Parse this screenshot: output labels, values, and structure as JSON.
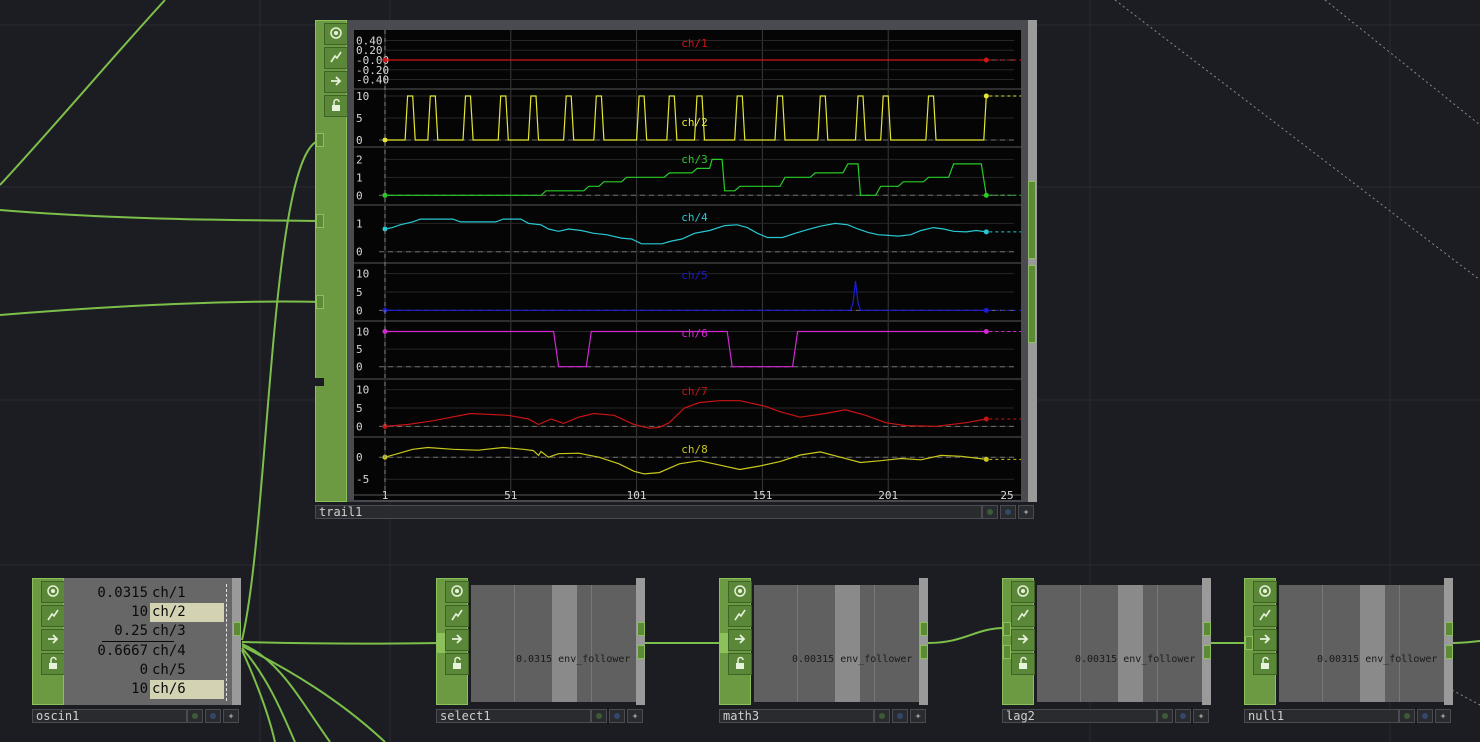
{
  "nodes": {
    "trail": {
      "name": "trail1"
    },
    "oscin": {
      "name": "oscin1",
      "values": [
        {
          "value": "0.0315",
          "channel": "ch/1"
        },
        {
          "value": "10",
          "channel": "ch/2"
        },
        {
          "value": "0.25",
          "channel": "ch/3"
        },
        {
          "value": "0.6667",
          "channel": "ch/4"
        },
        {
          "value": "0",
          "channel": "ch/5"
        },
        {
          "value": "10",
          "channel": "ch/6"
        }
      ]
    },
    "select": {
      "name": "select1",
      "value": "0.0315",
      "channel": "env_follower"
    },
    "math": {
      "name": "math3",
      "value": "0.00315",
      "channel": "env_follower"
    },
    "lag": {
      "name": "lag2",
      "value": "0.00315",
      "channel": "env_follower"
    },
    "null": {
      "name": "null1",
      "value": "0.00315",
      "channel": "env_follower"
    }
  },
  "icons": [
    "viewer-active-icon",
    "bypass-icon",
    "display-flag-icon",
    "lock-icon",
    "render-dot-icon",
    "clone-dot-icon",
    "expand-icon"
  ],
  "colors": {
    "background": "#1c1d22",
    "node_green": "#6b9a42",
    "wire": "#7cbf4a"
  },
  "chart_data": {
    "type": "line",
    "x_ticks": [
      "1",
      "51",
      "101",
      "151",
      "201",
      "25"
    ],
    "x_range": [
      1,
      251
    ],
    "series": [
      {
        "name": "ch/1",
        "color": "#d21414",
        "ticks": [
          "0.40",
          "0.20",
          "-0.00",
          "-0.20",
          "-0.40"
        ],
        "ylim": [
          -0.45,
          0.45
        ],
        "points": [
          [
            1,
            0
          ],
          [
            240,
            0
          ]
        ]
      },
      {
        "name": "ch/2",
        "color": "#e6e632",
        "ticks": [
          "10",
          "5",
          "0"
        ],
        "ylim": [
          0,
          10
        ],
        "points": [
          [
            1,
            0
          ],
          [
            9,
            0
          ],
          [
            10,
            10
          ],
          [
            12,
            10
          ],
          [
            13,
            0
          ],
          [
            18,
            0
          ],
          [
            19,
            10
          ],
          [
            21,
            10
          ],
          [
            22,
            0
          ],
          [
            32,
            0
          ],
          [
            33,
            10
          ],
          [
            35,
            10
          ],
          [
            36,
            0
          ],
          [
            46,
            0
          ],
          [
            47,
            10
          ],
          [
            49,
            10
          ],
          [
            50,
            0
          ],
          [
            58,
            0
          ],
          [
            59,
            10
          ],
          [
            61,
            10
          ],
          [
            62,
            0
          ],
          [
            72,
            0
          ],
          [
            73,
            10
          ],
          [
            75,
            10
          ],
          [
            76,
            0
          ],
          [
            84,
            0
          ],
          [
            85,
            10
          ],
          [
            87,
            10
          ],
          [
            88,
            0
          ],
          [
            101,
            0
          ],
          [
            102,
            10
          ],
          [
            104,
            10
          ],
          [
            105,
            0
          ],
          [
            113,
            0
          ],
          [
            114,
            10
          ],
          [
            116,
            10
          ],
          [
            117,
            0
          ],
          [
            124,
            0
          ],
          [
            125,
            10
          ],
          [
            127,
            10
          ],
          [
            128,
            0
          ],
          [
            140,
            0
          ],
          [
            141,
            10
          ],
          [
            143,
            10
          ],
          [
            144,
            0
          ],
          [
            156,
            0
          ],
          [
            157,
            10
          ],
          [
            159,
            10
          ],
          [
            160,
            0
          ],
          [
            173,
            0
          ],
          [
            174,
            10
          ],
          [
            176,
            10
          ],
          [
            177,
            0
          ],
          [
            188,
            0
          ],
          [
            189,
            10
          ],
          [
            191,
            10
          ],
          [
            192,
            0
          ],
          [
            198,
            0
          ],
          [
            199,
            10
          ],
          [
            201,
            10
          ],
          [
            202,
            0
          ],
          [
            216,
            0
          ],
          [
            217,
            10
          ],
          [
            219,
            10
          ],
          [
            220,
            0
          ],
          [
            239,
            0
          ],
          [
            240,
            10
          ]
        ]
      },
      {
        "name": "ch/3",
        "color": "#28cc28",
        "ticks": [
          "2",
          "1",
          "0"
        ],
        "ylim": [
          -0.15,
          2.3
        ],
        "points": [
          [
            1,
            0
          ],
          [
            63,
            0
          ],
          [
            65,
            0.25
          ],
          [
            80,
            0.25
          ],
          [
            82,
            0.5
          ],
          [
            86,
            0.5
          ],
          [
            88,
            0.75
          ],
          [
            95,
            0.75
          ],
          [
            97,
            1
          ],
          [
            112,
            1
          ],
          [
            114,
            1.25
          ],
          [
            123,
            1.25
          ],
          [
            125,
            1.5
          ],
          [
            130,
            1.5
          ],
          [
            131,
            2
          ],
          [
            135,
            2
          ],
          [
            136,
            0.25
          ],
          [
            140,
            0.25
          ],
          [
            142,
            0.5
          ],
          [
            158,
            0.5
          ],
          [
            160,
            1
          ],
          [
            170,
            1
          ],
          [
            172,
            1.25
          ],
          [
            183,
            1.25
          ],
          [
            185,
            1.75
          ],
          [
            189,
            1.75
          ],
          [
            190,
            0
          ],
          [
            196,
            0
          ],
          [
            198,
            0.5
          ],
          [
            205,
            0.5
          ],
          [
            207,
            0.75
          ],
          [
            215,
            0.75
          ],
          [
            217,
            1
          ],
          [
            225,
            1
          ],
          [
            227,
            1.75
          ],
          [
            238,
            1.75
          ],
          [
            240,
            0
          ]
        ]
      },
      {
        "name": "ch/4",
        "color": "#28c8d2",
        "ticks": [
          "1",
          "0"
        ],
        "ylim": [
          -0.15,
          1.4
        ],
        "points": [
          [
            1,
            0.8
          ],
          [
            4,
            0.85
          ],
          [
            7,
            0.95
          ],
          [
            12,
            1.05
          ],
          [
            15,
            1.15
          ],
          [
            28,
            1.15
          ],
          [
            31,
            1.05
          ],
          [
            45,
            1.05
          ],
          [
            48,
            1.15
          ],
          [
            55,
            1.15
          ],
          [
            58,
            1.0
          ],
          [
            63,
            0.95
          ],
          [
            66,
            0.8
          ],
          [
            70,
            0.72
          ],
          [
            74,
            0.8
          ],
          [
            79,
            0.75
          ],
          [
            84,
            0.65
          ],
          [
            89,
            0.6
          ],
          [
            95,
            0.48
          ],
          [
            99,
            0.45
          ],
          [
            103,
            0.28
          ],
          [
            111,
            0.28
          ],
          [
            115,
            0.38
          ],
          [
            119,
            0.45
          ],
          [
            124,
            0.65
          ],
          [
            130,
            0.75
          ],
          [
            136,
            0.92
          ],
          [
            141,
            0.95
          ],
          [
            145,
            0.85
          ],
          [
            149,
            0.65
          ],
          [
            153,
            0.5
          ],
          [
            159,
            0.5
          ],
          [
            164,
            0.65
          ],
          [
            169,
            0.78
          ],
          [
            174,
            0.9
          ],
          [
            180,
            1.0
          ],
          [
            185,
            0.95
          ],
          [
            189,
            0.8
          ],
          [
            193,
            0.68
          ],
          [
            197,
            0.6
          ],
          [
            205,
            0.55
          ],
          [
            210,
            0.6
          ],
          [
            214,
            0.75
          ],
          [
            219,
            0.85
          ],
          [
            223,
            0.8
          ],
          [
            227,
            0.72
          ],
          [
            232,
            0.7
          ],
          [
            236,
            0.75
          ],
          [
            240,
            0.7
          ]
        ]
      },
      {
        "name": "ch/5",
        "color": "#1c1cd2",
        "ticks": [
          "10",
          "5",
          "0"
        ],
        "ylim": [
          -1,
          11
        ],
        "points": [
          [
            1,
            0
          ],
          [
            186,
            0
          ],
          [
            187,
            2
          ],
          [
            188,
            8
          ],
          [
            189,
            2
          ],
          [
            190,
            0
          ],
          [
            240,
            0
          ]
        ]
      },
      {
        "name": "ch/6",
        "color": "#d228d2",
        "ticks": [
          "10",
          "5",
          "0"
        ],
        "ylim": [
          -1.5,
          11
        ],
        "points": [
          [
            1,
            10
          ],
          [
            68,
            10
          ],
          [
            70,
            0
          ],
          [
            81,
            0
          ],
          [
            83,
            10
          ],
          [
            137,
            10
          ],
          [
            139,
            0
          ],
          [
            163,
            0
          ],
          [
            165,
            10
          ],
          [
            240,
            10
          ]
        ]
      },
      {
        "name": "ch/7",
        "color": "#c81414",
        "ticks": [
          "10",
          "5",
          "0"
        ],
        "ylim": [
          -1,
          11
        ],
        "points": [
          [
            1,
            0
          ],
          [
            10,
            0.5
          ],
          [
            20,
            1.5
          ],
          [
            35,
            3.5
          ],
          [
            50,
            3
          ],
          [
            58,
            2
          ],
          [
            62,
            0.5
          ],
          [
            67,
            2
          ],
          [
            72,
            0.8
          ],
          [
            78,
            2.5
          ],
          [
            84,
            3.5
          ],
          [
            92,
            3
          ],
          [
            100,
            0.5
          ],
          [
            106,
            -0.5
          ],
          [
            110,
            -0.3
          ],
          [
            114,
            1
          ],
          [
            120,
            5
          ],
          [
            126,
            6.5
          ],
          [
            134,
            7
          ],
          [
            142,
            7
          ],
          [
            152,
            5.5
          ],
          [
            158,
            4
          ],
          [
            166,
            2.5
          ],
          [
            176,
            3.5
          ],
          [
            184,
            4.5
          ],
          [
            192,
            3
          ],
          [
            200,
            1
          ],
          [
            208,
            0.2
          ],
          [
            220,
            0
          ],
          [
            232,
            1
          ],
          [
            240,
            2
          ]
        ]
      },
      {
        "name": "ch/8",
        "color": "#c8c81c",
        "ticks": [
          "0",
          "-5"
        ],
        "ylim": [
          -7,
          3
        ],
        "points": [
          [
            1,
            0
          ],
          [
            6,
            0.8
          ],
          [
            12,
            1.8
          ],
          [
            18,
            2.2
          ],
          [
            28,
            1.8
          ],
          [
            38,
            1.6
          ],
          [
            48,
            2.2
          ],
          [
            56,
            1.8
          ],
          [
            60,
            1.5
          ],
          [
            62,
            0.4
          ],
          [
            63,
            1.3
          ],
          [
            66,
            0
          ],
          [
            70,
            0.8
          ],
          [
            78,
            0.9
          ],
          [
            86,
            0
          ],
          [
            94,
            -1.5
          ],
          [
            100,
            -3.2
          ],
          [
            104,
            -3.8
          ],
          [
            110,
            -3.5
          ],
          [
            118,
            -1.5
          ],
          [
            126,
            -0.8
          ],
          [
            134,
            -1.8
          ],
          [
            142,
            -2.8
          ],
          [
            150,
            -2
          ],
          [
            158,
            -1
          ],
          [
            166,
            0.5
          ],
          [
            174,
            1.2
          ],
          [
            182,
            0
          ],
          [
            190,
            -1.2
          ],
          [
            198,
            -0.8
          ],
          [
            206,
            -0.3
          ],
          [
            214,
            -0.6
          ],
          [
            222,
            0.4
          ],
          [
            230,
            0.2
          ],
          [
            240,
            -0.5
          ]
        ]
      }
    ]
  }
}
